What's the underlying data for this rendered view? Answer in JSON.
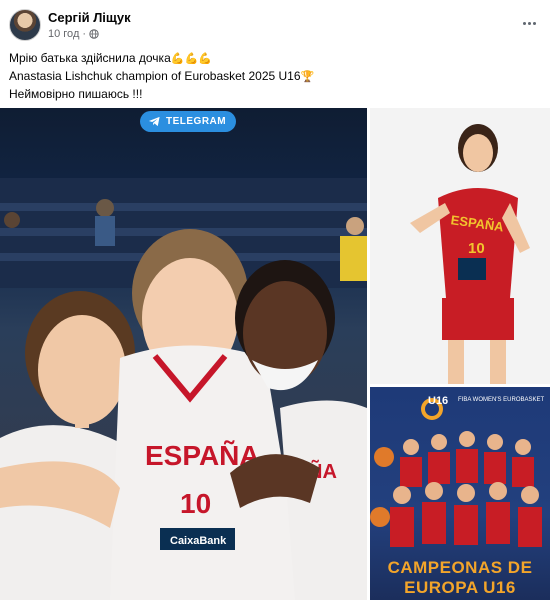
{
  "post": {
    "author": "Сергій Ліщук",
    "time": "10 год",
    "separator": "·",
    "privacy_icon": "globe-icon",
    "more_icon": "more-options-icon",
    "lines": [
      "Мрію батька здійснила дочка",
      "Anastasia Lishchuk champion of Eurobasket 2025 U16",
      "Неймовірно пишаюсь !!!"
    ],
    "emoji_line1": "💪💪💪",
    "emoji_line2": "🏆"
  },
  "media": {
    "badge_label": "TELEGRAM",
    "badge_color": "#2b8fe0",
    "jersey_text": "ESPAÑA",
    "jersey_number": "10",
    "sponsor": "CaixaBank",
    "poster_title": "U16",
    "poster_sub": "FIBA WOMEN'S EUROBASKET",
    "poster_footer": "CAMPEONAS DE EUROPA U16"
  }
}
